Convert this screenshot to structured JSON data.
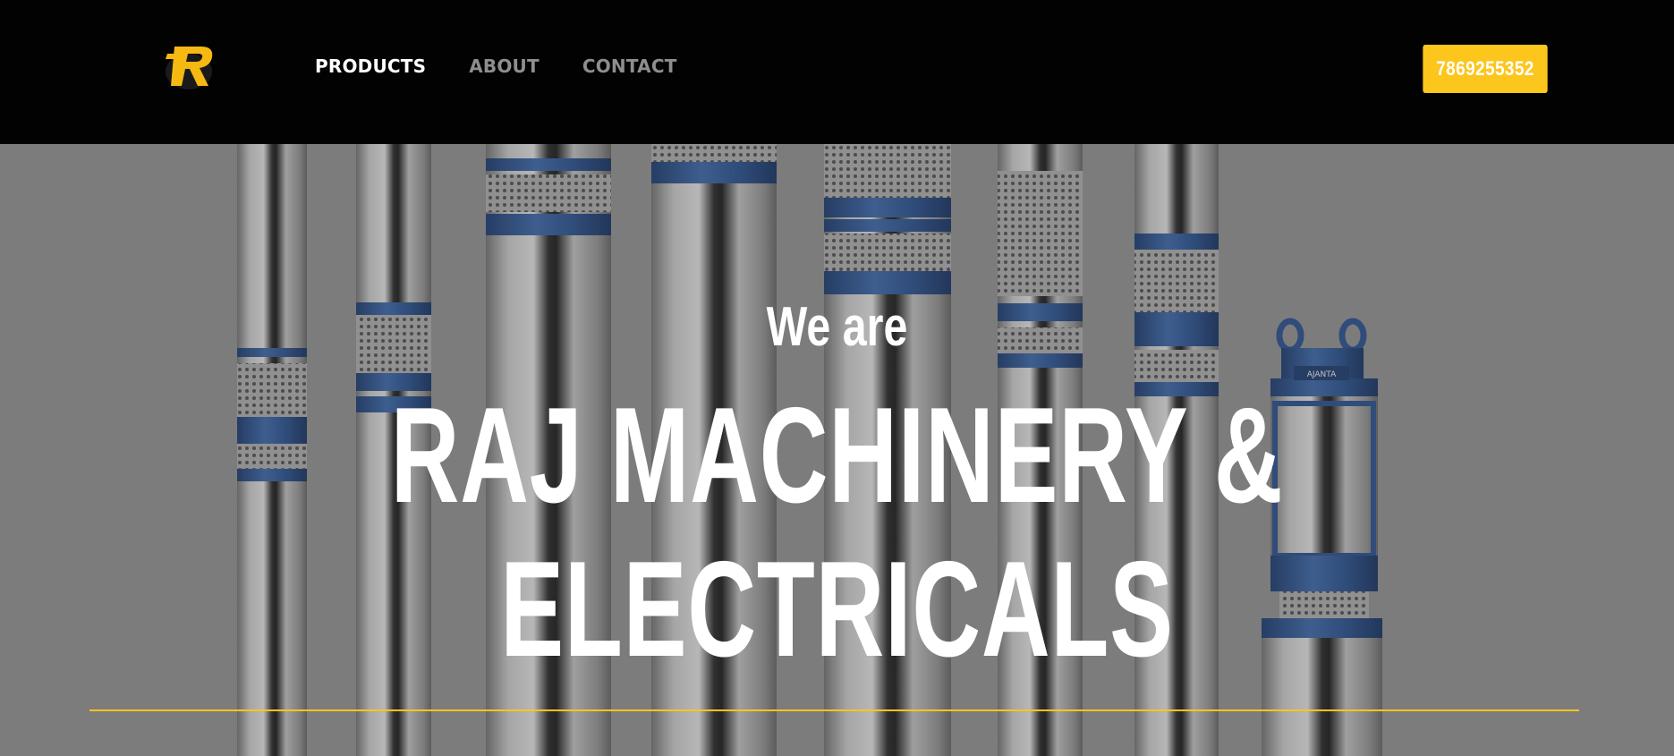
{
  "header": {
    "logo_letter": "R",
    "logo_icon": "r-brand-logo-icon",
    "nav": [
      {
        "label": "PRODUCTS",
        "active": true
      },
      {
        "label": "ABOUT",
        "active": false
      },
      {
        "label": "CONTACT",
        "active": false
      }
    ],
    "phone": "7869255352"
  },
  "hero": {
    "pretitle": "We are",
    "title_line1": "RAJ MACHINERY &",
    "title_line2": "ELECTRICALS",
    "pump_brand_label": "AJANTA",
    "background": "submersible-pumps-photo"
  },
  "colors": {
    "accent": "#fcc61d",
    "header_bg": "#020202",
    "nav_active": "#ffffff",
    "nav_inactive": "#8e8e8e",
    "hero_text": "#ffffff"
  }
}
